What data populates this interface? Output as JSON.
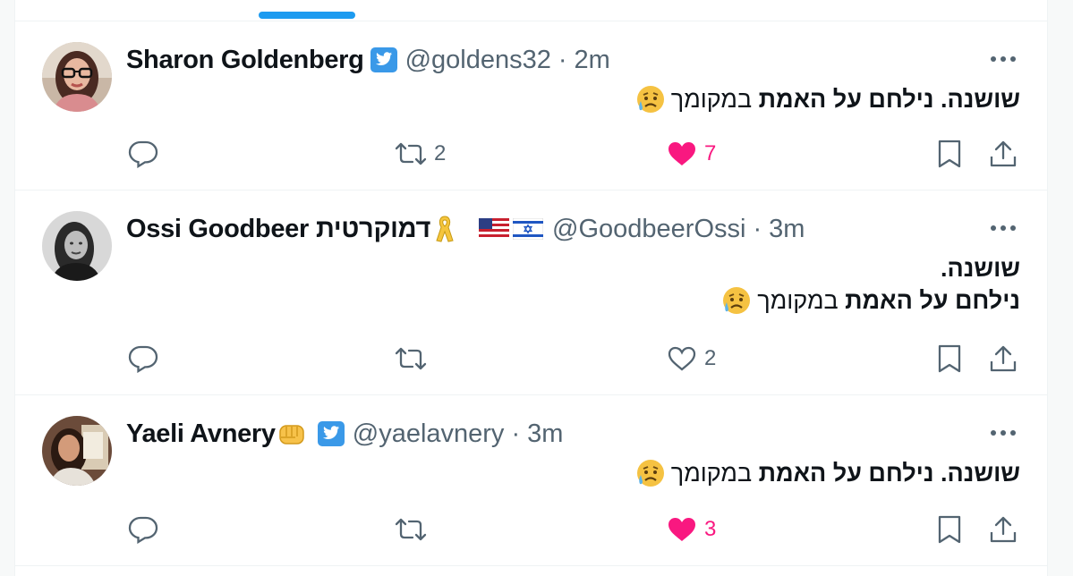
{
  "tweets": [
    {
      "name": "Sharon Goldenberg",
      "handle": "@goldens32",
      "separator": "·",
      "time": "2m",
      "text_bold": "שושנה.",
      "text_bold_2": "נילחם על האמת",
      "text_light": "במקומך",
      "emoji": "sad-relieved-face-emoji",
      "verified": true,
      "replies": "",
      "retweets": "2",
      "likes": "7",
      "liked": true
    },
    {
      "name": "Ossi Goodbeer",
      "name_suffix": "דמוקרטית",
      "handle": "@GoodbeerOssi",
      "separator": "·",
      "time": "3m",
      "line1": "שושנה.",
      "line2_bold": "נילחם על האמת",
      "line2_light": "במקומך",
      "emoji": "sad-relieved-face-emoji",
      "badges": [
        "yellow-ribbon-emoji",
        "us-flag-emoji",
        "israel-flag-emoji"
      ],
      "replies": "",
      "retweets": "",
      "likes": "2",
      "liked": false
    },
    {
      "name": "Yaeli Avnery",
      "handle": "@yaelavnery",
      "separator": "·",
      "time": "3m",
      "text_bold": "שושנה.",
      "text_bold_2": "נילחם על האמת",
      "text_light": "במקומך",
      "emoji": "sad-relieved-face-emoji",
      "name_emoji": "fist-emoji",
      "verified": true,
      "replies": "",
      "retweets": "",
      "likes": "3",
      "liked": true
    }
  ],
  "colors": {
    "accent": "#1d9bf0",
    "like": "#f91880",
    "secondary_text": "#536471",
    "divider": "#eff3f4"
  }
}
